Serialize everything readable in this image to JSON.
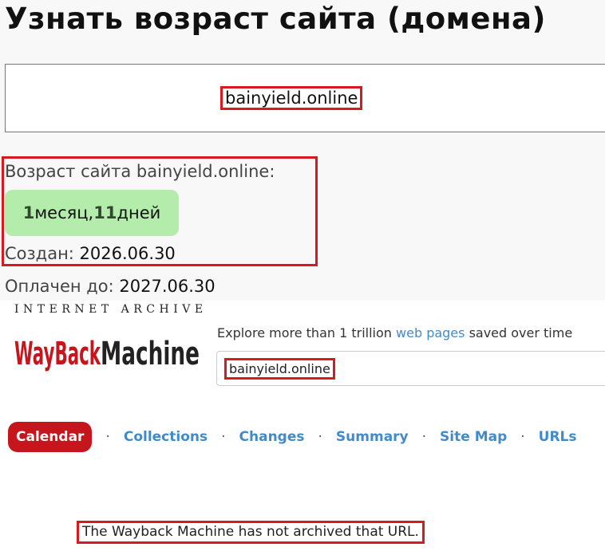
{
  "page": {
    "title": "Узнать возраст сайта (домена)"
  },
  "domain_input": {
    "value": "bainyield.online"
  },
  "result": {
    "label": "Возраст сайта bainyield.online:",
    "age_months": "1",
    "age_months_unit": " месяц, ",
    "age_days": "11",
    "age_days_unit": " дней",
    "created_label": "Создан: ",
    "created_value": "2026.06.30",
    "paid_label": "Оплачен до: ",
    "paid_value": "2027.06.30"
  },
  "wayback": {
    "logo_top": "INTERNET ARCHIVE",
    "logo_main": "WayBackMachine",
    "tagline_prefix": "Explore more than 1 trillion ",
    "tagline_link": "web pages",
    "tagline_suffix": " saved over time",
    "search_value": "bainyield.online",
    "tabs": {
      "calendar": "Calendar",
      "collections": "Collections",
      "changes": "Changes",
      "summary": "Summary",
      "site_map": "Site Map",
      "urls": "URLs"
    },
    "message": "The Wayback Machine has not archived that URL."
  },
  "colors": {
    "highlight_border": "#d71920",
    "age_badge": "#b4ecab",
    "wayback_red": "#c4161c",
    "link_blue": "#428bca"
  }
}
